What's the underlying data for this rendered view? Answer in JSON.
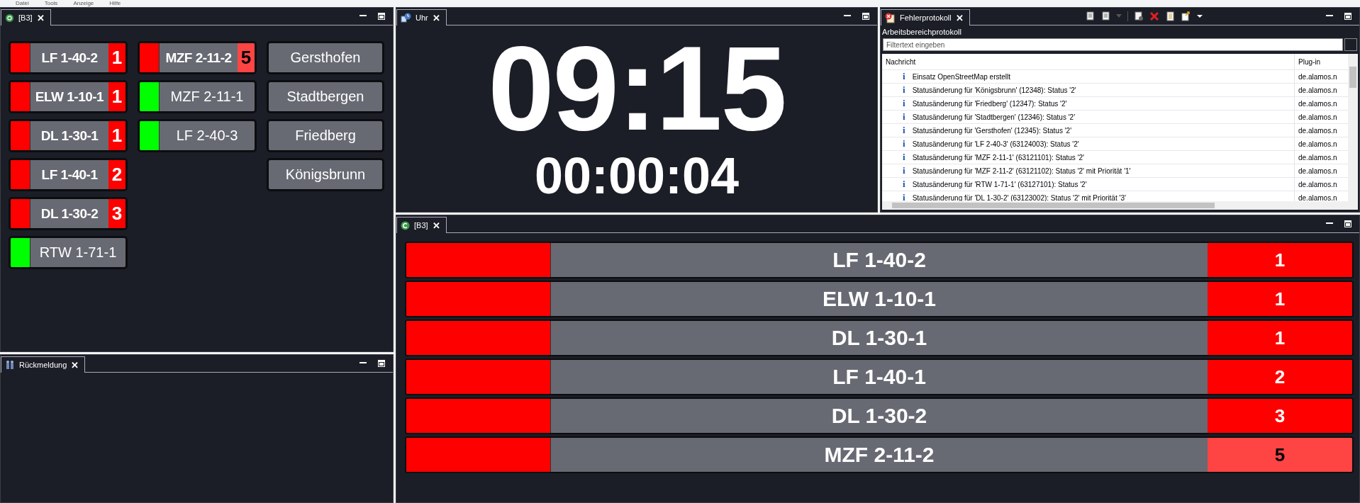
{
  "menu": [
    "Datei",
    "Tools",
    "Anzeige",
    "Hilfe"
  ],
  "vehicle_panel": {
    "tab": "[B3]",
    "close": "✕",
    "columns": [
      [
        {
          "name": "LF 1-40-2",
          "color": "#ff0000",
          "priority": {
            "text": "1",
            "highlighted": false
          }
        },
        {
          "name": "ELW 1-10-1",
          "color": "#ff0000",
          "priority": {
            "text": "1",
            "highlighted": false
          }
        },
        {
          "name": "DL 1-30-1",
          "color": "#ff0000",
          "priority": {
            "text": "1",
            "highlighted": false
          }
        },
        {
          "name": "LF 1-40-1",
          "color": "#ff0000",
          "priority": {
            "text": "2",
            "highlighted": false
          }
        },
        {
          "name": "DL 1-30-2",
          "color": "#ff0000",
          "priority": {
            "text": "3",
            "highlighted": false
          }
        },
        {
          "name": "RTW 1-71-1",
          "color": "#00ff00"
        }
      ],
      [
        {
          "name": "MZF 2-11-2",
          "color": "#ff0000",
          "priority": {
            "text": "5",
            "highlighted": true
          }
        },
        {
          "name": "MZF 2-11-1",
          "color": "#00ff00"
        },
        {
          "name": "LF 2-40-3",
          "color": "#00ff00"
        }
      ]
    ],
    "stations": [
      "Gersthofen",
      "Stadtbergen",
      "Friedberg",
      "Königsbrunn"
    ]
  },
  "feedback_panel": {
    "tab": "Rückmeldung",
    "close": "✕"
  },
  "clock_panel": {
    "tab": "Uhr",
    "close": "✕",
    "time": "09:15",
    "elapsed": "00:00:04"
  },
  "log_panel": {
    "tab": "Fehlerprotokoll",
    "close": "✕",
    "subtitle": "Arbeitsbereichprotokoll",
    "filter": {
      "placeholder": "Filtertext eingeben"
    },
    "columns": [
      "Nachricht",
      "Plug-in"
    ],
    "rows": [
      {
        "icon": "i",
        "message": "Einsatz OpenStreetMap erstellt",
        "plugin": "de.alamos.n"
      },
      {
        "icon": "i",
        "message": "Statusänderung für 'Königsbrunn' (12348): Status '2'",
        "plugin": "de.alamos.n"
      },
      {
        "icon": "i",
        "message": "Statusänderung für 'Friedberg' (12347): Status '2'",
        "plugin": "de.alamos.n"
      },
      {
        "icon": "i",
        "message": "Statusänderung für 'Stadtbergen' (12346): Status '2'",
        "plugin": "de.alamos.n"
      },
      {
        "icon": "i",
        "message": "Statusänderung für 'Gersthofen' (12345): Status '2'",
        "plugin": "de.alamos.n"
      },
      {
        "icon": "i",
        "message": "Statusänderung für 'LF 2-40-3' (63124003): Status '2'",
        "plugin": "de.alamos.n"
      },
      {
        "icon": "i",
        "message": "Statusänderung für 'MZF 2-11-1' (63121101): Status '2'",
        "plugin": "de.alamos.n"
      },
      {
        "icon": "i",
        "message": "Statusänderung für 'MZF 2-11-2' (63121102): Status '2' mit Priorität '1'",
        "plugin": "de.alamos.n"
      },
      {
        "icon": "i",
        "message": "Statusänderung für 'RTW 1-71-1' (63127101): Status '2'",
        "plugin": "de.alamos.n"
      },
      {
        "icon": "i",
        "message": "Statusänderung für 'DL 1-30-2' (63123002): Status '2' mit Priorität '3'",
        "plugin": "de.alamos.n"
      }
    ]
  },
  "alarm_panel": {
    "tab": "[B3]",
    "close": "✕",
    "rows": [
      {
        "name": "LF 1-40-2",
        "color": "#ff0000",
        "priority": {
          "text": "1",
          "highlighted": false
        }
      },
      {
        "name": "ELW 1-10-1",
        "color": "#ff0000",
        "priority": {
          "text": "1",
          "highlighted": false
        }
      },
      {
        "name": "DL 1-30-1",
        "color": "#ff0000",
        "priority": {
          "text": "1",
          "highlighted": false
        }
      },
      {
        "name": "LF 1-40-1",
        "color": "#ff0000",
        "priority": {
          "text": "2",
          "highlighted": false
        }
      },
      {
        "name": "DL 1-30-2",
        "color": "#ff0000",
        "priority": {
          "text": "3",
          "highlighted": false
        }
      },
      {
        "name": "MZF 2-11-2",
        "color": "#ff0000",
        "priority": {
          "text": "5",
          "highlighted": true
        }
      }
    ]
  }
}
